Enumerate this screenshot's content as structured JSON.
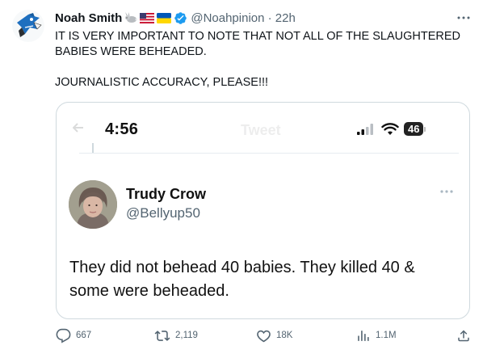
{
  "tweet": {
    "author_name": "Noah Smith",
    "author_handle_time": "@Noahpinion · 22h",
    "text_line1": "IT IS VERY IMPORTANT TO NOTE THAT NOT ALL OF THE SLAUGHTERED BABIES WERE BEHEADED.",
    "text_line2": "JOURNALISTIC ACCURACY, PLEASE!!!",
    "name_emojis": [
      "rabbit-emoji",
      "us-flag-emoji",
      "ukraine-flag-emoji",
      "verified-badge-icon"
    ]
  },
  "quoted_screenshot": {
    "status_time": "4:56",
    "battery_level": "46",
    "ghost_title": "Tweet",
    "author_name": "Trudy Crow",
    "author_handle": "@Bellyup50",
    "text": "They did not behead 40 babies. They killed 40 & some were beheaded."
  },
  "actions": {
    "replies": "667",
    "retweets": "2,119",
    "likes": "18K",
    "views": "1.1M"
  },
  "colors": {
    "text_primary": "#0f1419",
    "text_secondary": "#536471",
    "border": "#cfd9de",
    "verified_blue": "#1d9bf0"
  }
}
